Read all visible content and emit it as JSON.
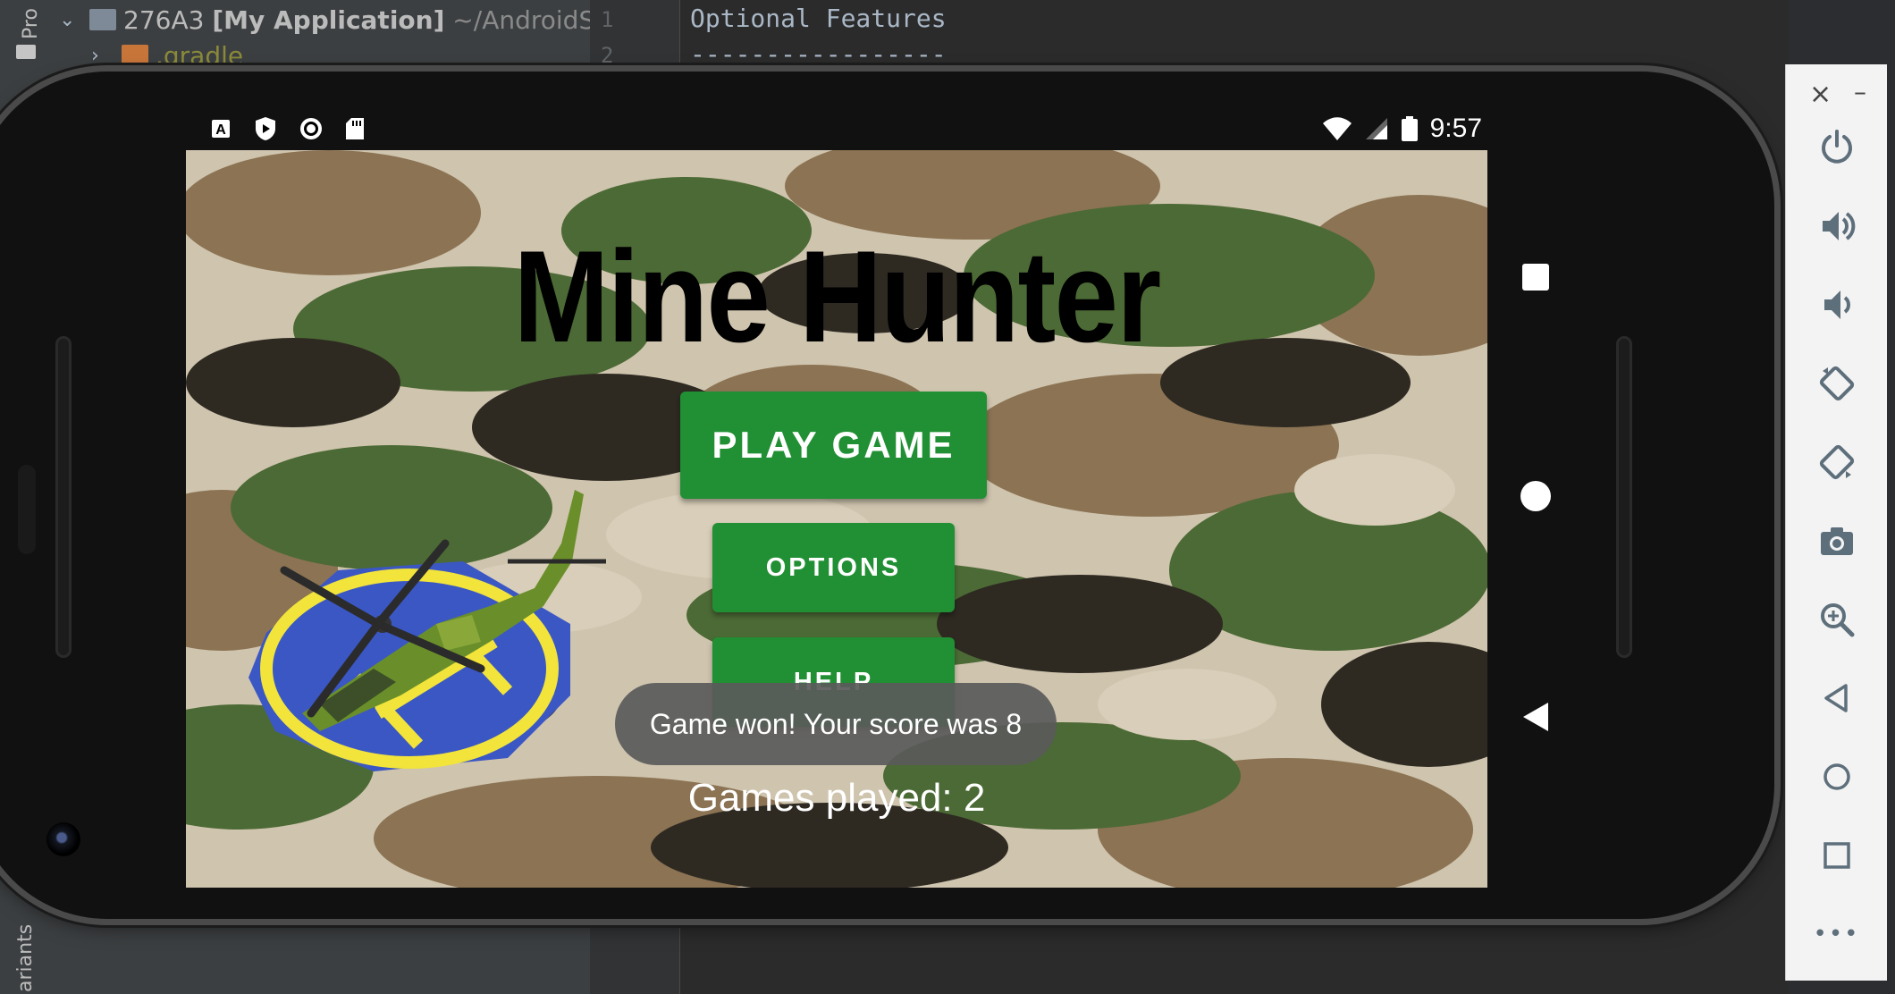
{
  "ide": {
    "tool_window_project": "Pro",
    "tool_window_variants": "ariants",
    "tree_row_1": {
      "name": "276A3",
      "module": "[My Application]",
      "path": "~/AndroidStudi"
    },
    "tree_row_2": {
      "name": ".gradle"
    },
    "line_numbers": [
      "1",
      "2"
    ],
    "code_lines": [
      "Optional Features",
      "-----------------"
    ]
  },
  "status_bar": {
    "time": "9:57",
    "left_icons": [
      "a-box-icon",
      "play-shield-icon",
      "record-icon",
      "sd-card-icon"
    ],
    "right_icons": [
      "wifi-icon",
      "signal-icon",
      "battery-icon"
    ]
  },
  "app": {
    "title": "Mine Hunter",
    "play_button": "PLAY GAME",
    "options_button": "OPTIONS",
    "help_button": "HELP",
    "toast": "Game won! Your score was 8",
    "games_played": "Games played: 2",
    "button_color": "#218f33"
  },
  "nav": [
    "square-icon",
    "circle-icon",
    "back-triangle-icon"
  ],
  "emulator_toolbar": {
    "close": "×",
    "minimize": "–",
    "buttons": [
      "power-icon",
      "volume-up-icon",
      "volume-down-icon",
      "rotate-left-icon",
      "rotate-right-icon",
      "camera-icon",
      "zoom-icon",
      "back-icon",
      "home-icon",
      "overview-icon",
      "more-icon"
    ],
    "more_label": "•••"
  }
}
